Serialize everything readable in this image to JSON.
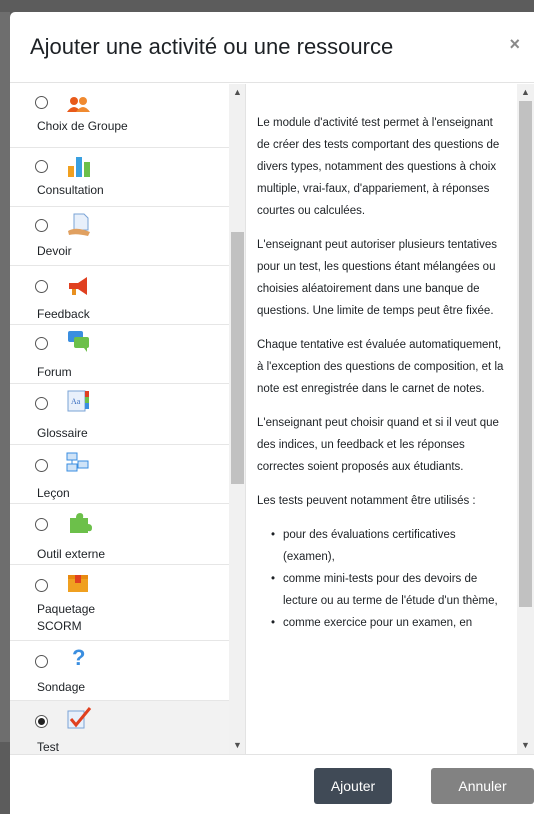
{
  "dialog": {
    "title": "Ajouter une activité ou une ressource",
    "close_glyph": "×"
  },
  "options": [
    {
      "label": "Choix de Groupe",
      "icon": "group-choice-icon",
      "selected": false
    },
    {
      "label": "Consultation",
      "icon": "bar-chart-icon",
      "selected": false
    },
    {
      "label": "Devoir",
      "icon": "assignment-icon",
      "selected": false
    },
    {
      "label": "Feedback",
      "icon": "megaphone-icon",
      "selected": false
    },
    {
      "label": "Forum",
      "icon": "speech-bubbles-icon",
      "selected": false
    },
    {
      "label": "Glossaire",
      "icon": "glossary-icon",
      "selected": false
    },
    {
      "label": "Leçon",
      "icon": "lesson-icon",
      "selected": false
    },
    {
      "label": "Outil externe",
      "icon": "puzzle-icon",
      "selected": false
    },
    {
      "label": "Paquetage",
      "label2": "SCORM",
      "icon": "package-icon",
      "selected": false
    },
    {
      "label": "Sondage",
      "icon": "question-mark-icon",
      "selected": false
    },
    {
      "label": "Test",
      "icon": "quiz-checkmark-icon",
      "selected": true
    }
  ],
  "description": {
    "p1": "Le module d'activité test permet à l'enseignant de créer des tests comportant des questions de divers types, notamment des questions à choix multiple, vrai-faux, d'appariement, à réponses courtes ou calculées.",
    "p2": "L'enseignant peut autoriser plusieurs tentatives pour un test, les questions étant mélangées ou choisies aléatoirement dans une banque de questions. Une limite de temps peut être fixée.",
    "p3": "Chaque tentative est évaluée automatiquement, à l'exception des questions de composition, et la note est enregistrée dans le carnet de notes.",
    "p4": "L'enseignant peut choisir quand et si il veut que des indices, un feedback et les réponses correctes soient proposés aux étudiants.",
    "p5": "Les tests peuvent notamment être utilisés :",
    "bullets": [
      "pour des évaluations certificatives (examen),",
      "comme mini-tests pour des devoirs de lecture ou au terme de l'étude d'un thème,",
      "comme exercice pour un examen, en"
    ]
  },
  "footer": {
    "add_label": "Ajouter",
    "cancel_label": "Annuler"
  },
  "colors": {
    "primary_button": "#404a56",
    "secondary_button": "#828282"
  }
}
